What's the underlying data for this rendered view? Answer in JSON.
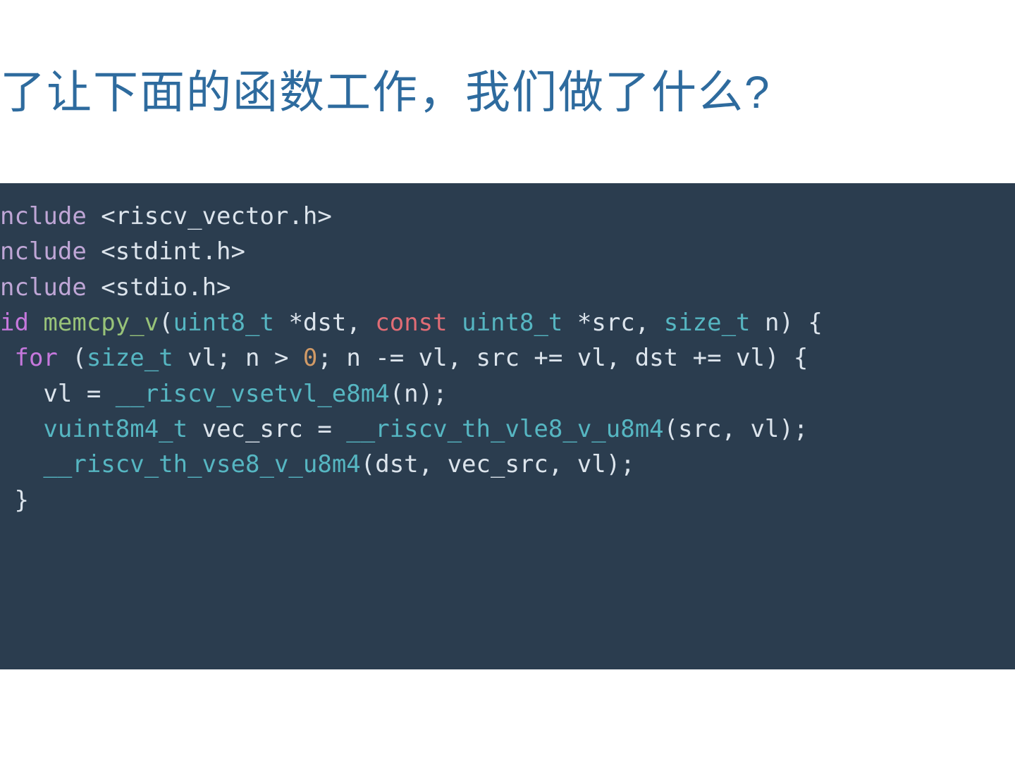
{
  "title": "了让下面的函数工作，我们做了什么?",
  "code": {
    "l1_include": "nclude",
    "l1_rest": " <riscv_vector.h>",
    "l2_include": "nclude",
    "l2_rest": " <stdint.h>",
    "l3_include": "nclude",
    "l3_rest": " <stdio.h>",
    "blank": "",
    "l5_void": "id ",
    "l5_func": "memcpy_v",
    "l5_open": "(",
    "l5_type1": "uint8_t",
    "l5_mid1": " *dst, ",
    "l5_const": "const",
    "l5_space": " ",
    "l5_type2": "uint8_t",
    "l5_mid2": " *src, ",
    "l5_type3": "size_t",
    "l5_end": " n) {",
    "l6_for": " for",
    "l6_open": " (",
    "l6_type": "size_t",
    "l6_mid1": " vl; n > ",
    "l6_zero": "0",
    "l6_rest": "; n -= vl, src += vl, dst += vl) {",
    "l7_pre": "   vl = ",
    "l7_fn": "__riscv_vsetvl_e8m4",
    "l7_rest": "(n);",
    "l8_pre": "   ",
    "l8_type": "vuint8m4_t",
    "l8_mid": " vec_src = ",
    "l8_fn": "__riscv_th_vle8_v_u8m4",
    "l8_rest": "(src, vl);",
    "l9_pre": "   ",
    "l9_fn": "__riscv_th_vse8_v_u8m4",
    "l9_rest": "(dst, vec_src, vl);",
    "l10": " }"
  }
}
